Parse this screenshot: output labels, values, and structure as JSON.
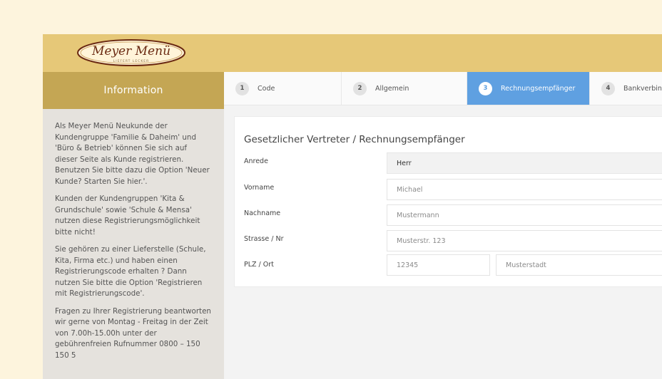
{
  "logo": {
    "brand": "Meyer Menü",
    "tagline": "LIEFERT LECKER"
  },
  "sidebar": {
    "title": "Information",
    "paragraphs": [
      "Als Meyer Menü Neukunde der Kundengruppe 'Familie & Daheim' und 'Büro & Betrieb' können Sie sich auf dieser Seite als Kunde registrieren. Benutzen Sie bitte dazu die Option 'Neuer Kunde? Starten Sie hier.'.",
      "Kunden der Kundengruppen 'Kita & Grundschule' sowie 'Schule & Mensa' nutzen diese Registrierungsmöglichkeit bitte nicht!",
      "Sie gehören zu einer Lieferstelle (Schule, Kita, Firma etc.) und haben einen Registrierungscode erhalten ? Dann nutzen Sie bitte die Option 'Registrieren mit Registrierungscode'.",
      "Fragen zu Ihrer Registrierung beantworten wir gerne von Montag - Freitag in der Zeit von 7.00h-15.00h unter der gebührenfreien Rufnummer 0800 – 150 150 5"
    ]
  },
  "steps": [
    {
      "number": "1",
      "label": "Code"
    },
    {
      "number": "2",
      "label": "Allgemein"
    },
    {
      "number": "3",
      "label": "Rechnungsempfänger"
    },
    {
      "number": "4",
      "label": "Bankverbindung"
    }
  ],
  "active_step": 3,
  "form": {
    "title": "Gesetzlicher Vertreter / Rechnungsempfänger",
    "anrede": {
      "label": "Anrede",
      "value": "Herr"
    },
    "vorname": {
      "label": "Vorname",
      "placeholder": "Michael"
    },
    "nachname": {
      "label": "Nachname",
      "placeholder": "Mustermann"
    },
    "strasse": {
      "label": "Strasse / Nr",
      "placeholder": "Musterstr. 123"
    },
    "plz_ort": {
      "label": "PLZ / Ort",
      "plz_placeholder": "12345",
      "ort_placeholder": "Musterstadt"
    }
  },
  "colors": {
    "page_bg": "#fdf4dd",
    "header_bg": "#e6c878",
    "sidebar_head": "#c4a654",
    "active_step": "#5fa0e1",
    "logo_text": "#6b2a12"
  }
}
